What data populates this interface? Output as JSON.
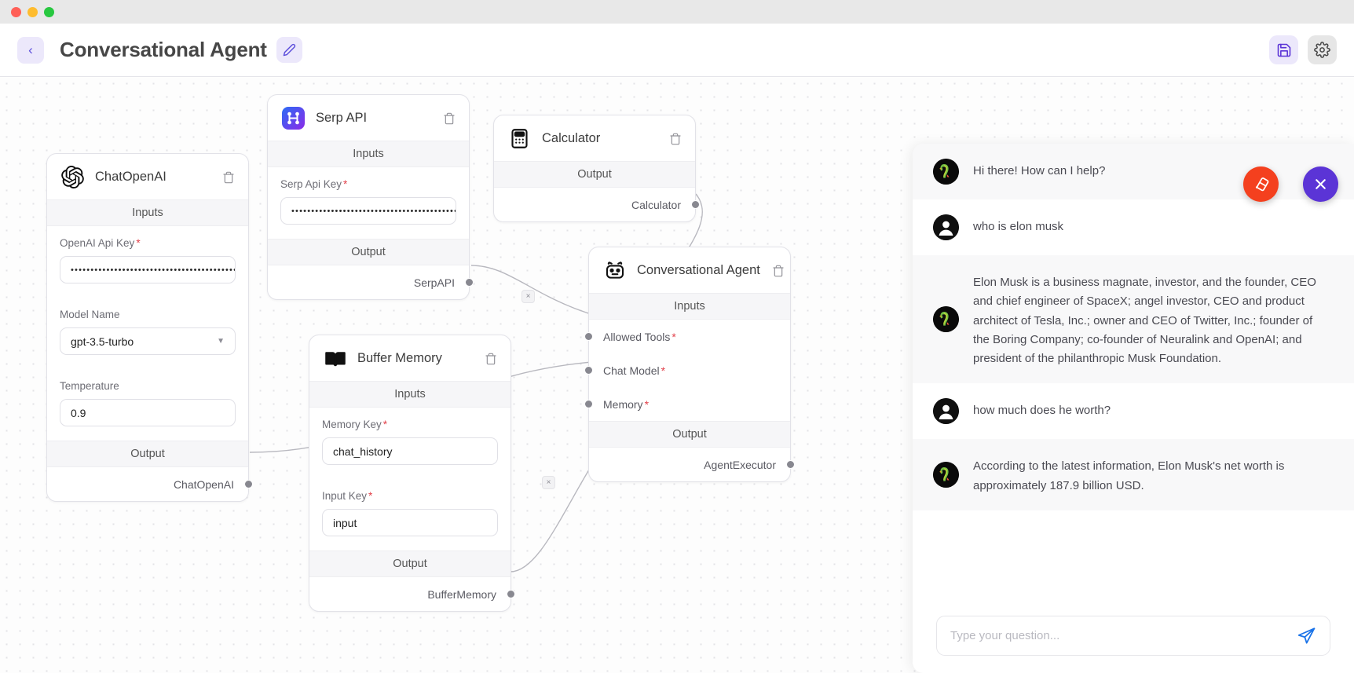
{
  "window": {
    "traffic_lights": [
      "close",
      "minimize",
      "zoom"
    ]
  },
  "header": {
    "back_label": "‹",
    "title": "Conversational Agent",
    "edit_icon": "pencil-icon",
    "save_icon": "save-icon",
    "settings_icon": "gear-icon"
  },
  "canvas": {
    "clear_button_icon": "eraser-icon",
    "close_button_icon": "close-icon",
    "edge_delete_label": "×"
  },
  "nodes": {
    "chatopenai": {
      "title": "ChatOpenAI",
      "icon": "openai-icon",
      "inputs_label": "Inputs",
      "output_label": "Output",
      "fields": [
        {
          "label": "OpenAI Api Key",
          "required": true,
          "type": "password",
          "value": "••••••••••••••••••••••••••••••••••••••••••••••"
        },
        {
          "label": "Model Name",
          "required": false,
          "type": "select",
          "value": "gpt-3.5-turbo"
        },
        {
          "label": "Temperature",
          "required": false,
          "type": "text",
          "value": "0.9"
        }
      ],
      "outputs": [
        {
          "label": "ChatOpenAI"
        }
      ]
    },
    "serpapi": {
      "title": "Serp API",
      "icon": "serpapi-icon",
      "inputs_label": "Inputs",
      "output_label": "Output",
      "fields": [
        {
          "label": "Serp Api Key",
          "required": true,
          "type": "password",
          "value": "••••••••••••••••••••••••••••••••••••••••••••••"
        }
      ],
      "outputs": [
        {
          "label": "SerpAPI"
        }
      ]
    },
    "calculator": {
      "title": "Calculator",
      "icon": "calculator-icon",
      "output_label": "Output",
      "outputs": [
        {
          "label": "Calculator"
        }
      ]
    },
    "buffer_memory": {
      "title": "Buffer Memory",
      "icon": "book-icon",
      "inputs_label": "Inputs",
      "output_label": "Output",
      "fields": [
        {
          "label": "Memory Key",
          "required": true,
          "type": "text",
          "value": "chat_history"
        },
        {
          "label": "Input Key",
          "required": true,
          "type": "text",
          "value": "input"
        }
      ],
      "outputs": [
        {
          "label": "BufferMemory"
        }
      ]
    },
    "conversational_agent": {
      "title": "Conversational Agent",
      "icon": "robot-icon",
      "inputs_label": "Inputs",
      "output_label": "Output",
      "inputs": [
        {
          "label": "Allowed Tools",
          "required": true
        },
        {
          "label": "Chat Model",
          "required": true
        },
        {
          "label": "Memory",
          "required": true
        }
      ],
      "outputs": [
        {
          "label": "AgentExecutor"
        }
      ]
    }
  },
  "chat": {
    "messages": [
      {
        "role": "bot",
        "text": "Hi there! How can I help?"
      },
      {
        "role": "user",
        "text": "who is elon musk"
      },
      {
        "role": "bot",
        "text": "Elon Musk is a business magnate, investor, and the founder, CEO and chief engineer of SpaceX; angel investor, CEO and product architect of Tesla, Inc.; owner and CEO of Twitter, Inc.; founder of the Boring Company; co-founder of Neuralink and OpenAI; and president of the philanthropic Musk Foundation."
      },
      {
        "role": "user",
        "text": "how much does he worth?"
      },
      {
        "role": "bot",
        "text": "According to the latest information, Elon Musk's net worth is approximately 187.9 billion USD."
      }
    ],
    "input": {
      "placeholder": "Type your question...",
      "value": "",
      "send_icon": "send-icon"
    }
  },
  "colors": {
    "accent_purple": "#5b34d6",
    "accent_light": "#ece8fb",
    "danger_red": "#f4401e",
    "required_star": "#e2404a",
    "send_blue": "#1a73e8"
  }
}
